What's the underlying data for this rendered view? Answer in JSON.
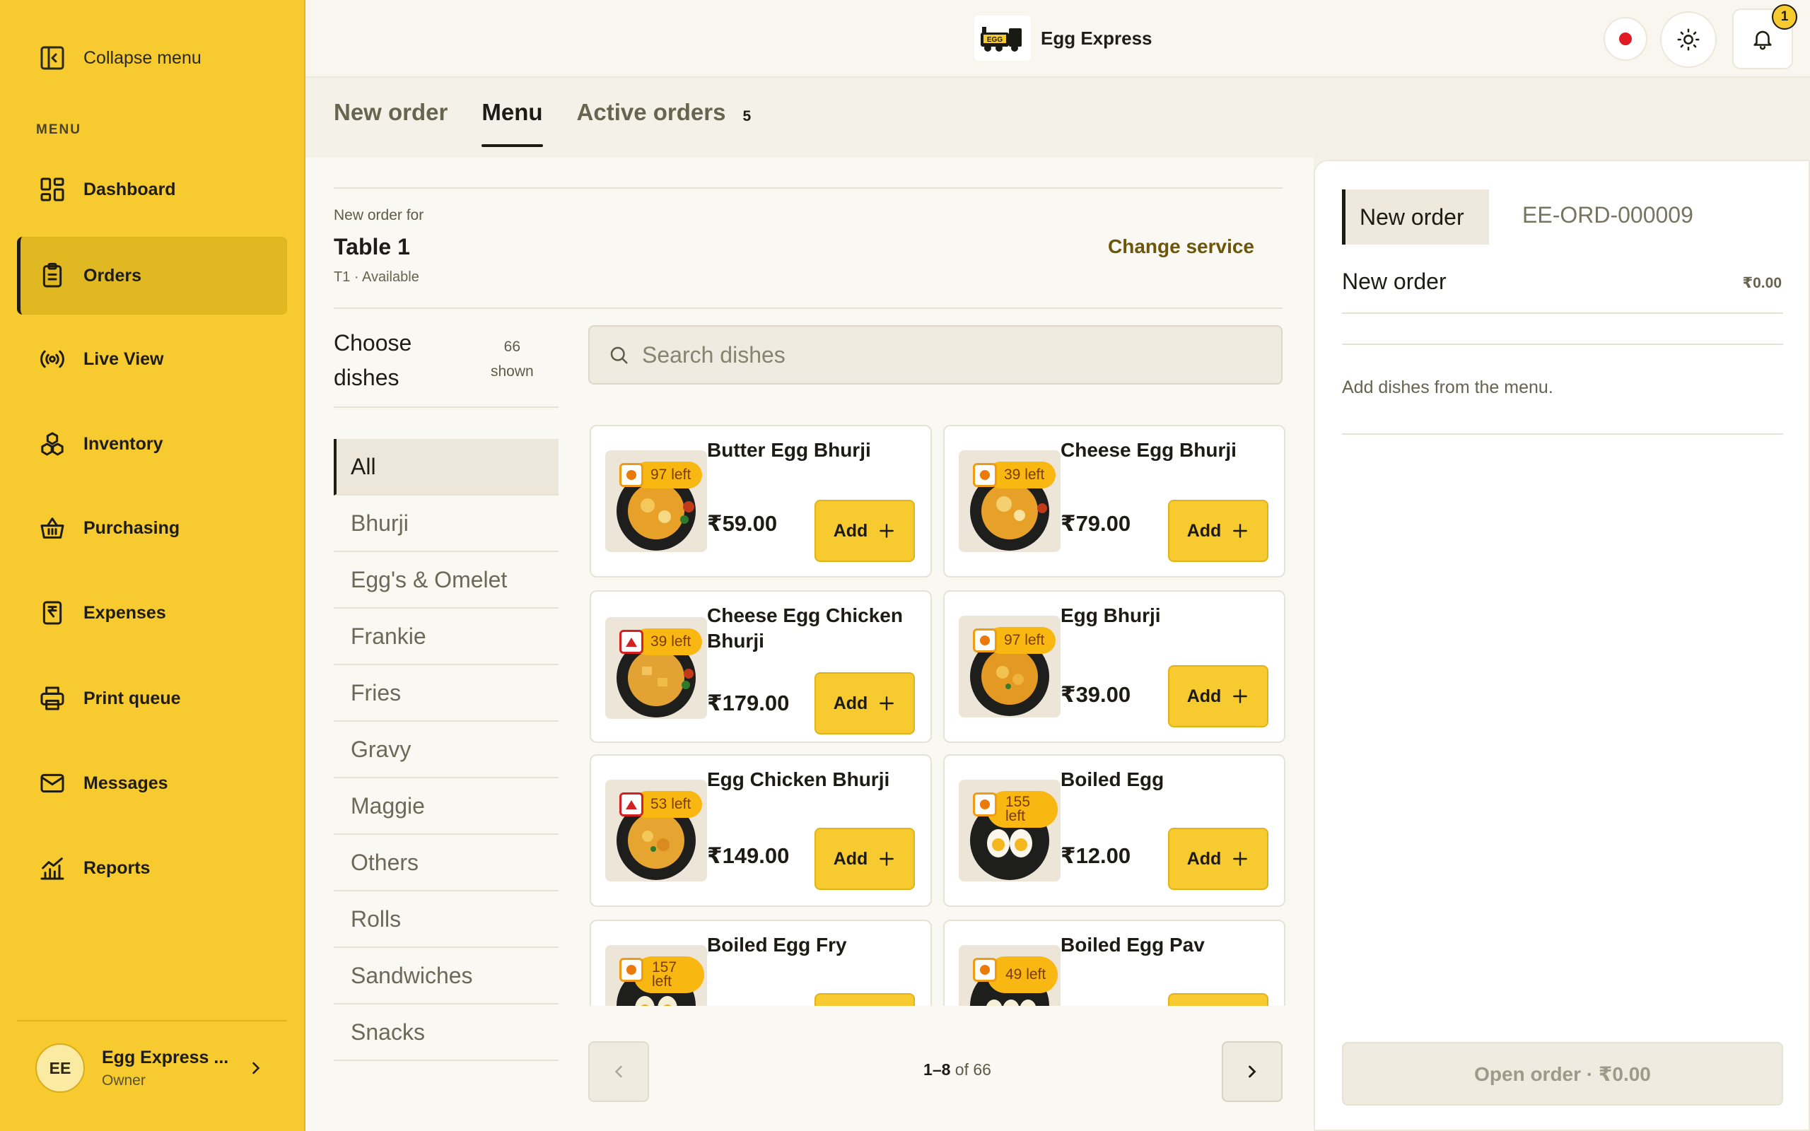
{
  "sidebar": {
    "collapse_label": "Collapse menu",
    "section_label": "MENU",
    "items": [
      {
        "label": "Dashboard",
        "icon": "dashboard-icon"
      },
      {
        "label": "Orders",
        "icon": "clipboard-icon",
        "active": true
      },
      {
        "label": "Live View",
        "icon": "broadcast-icon"
      },
      {
        "label": "Inventory",
        "icon": "boxes-icon"
      },
      {
        "label": "Purchasing",
        "icon": "basket-icon"
      },
      {
        "label": "Expenses",
        "icon": "rupee-receipt-icon"
      },
      {
        "label": "Print queue",
        "icon": "printer-icon"
      },
      {
        "label": "Messages",
        "icon": "mail-icon"
      },
      {
        "label": "Reports",
        "icon": "chart-icon"
      }
    ],
    "user": {
      "initials": "EE",
      "name": "Egg Express ...",
      "role": "Owner"
    }
  },
  "topbar": {
    "brand_name": "Egg Express",
    "logo_text": "EGG",
    "notification_count": "1"
  },
  "tabs": [
    {
      "label": "New order"
    },
    {
      "label": "Menu",
      "active": true
    },
    {
      "label": "Active orders",
      "count": "5"
    }
  ],
  "order_header": {
    "for_label": "New order for",
    "table_name": "Table 1",
    "table_status": "T1 · Available",
    "change_service": "Change service"
  },
  "dishes_header": {
    "title": "Choose dishes",
    "count": "66",
    "count_suffix": "shown"
  },
  "categories": [
    "All",
    "Bhurji",
    "Egg's & Omelet",
    "Frankie",
    "Fries",
    "Gravy",
    "Maggie",
    "Others",
    "Rolls",
    "Sandwiches",
    "Snacks"
  ],
  "search": {
    "placeholder": "Search dishes"
  },
  "add_label": "Add",
  "dishes": [
    {
      "name": "Butter Egg Bhurji",
      "price": "₹59.00",
      "stock": "97 left",
      "type": "veg"
    },
    {
      "name": "Cheese Egg Bhurji",
      "price": "₹79.00",
      "stock": "39 left",
      "type": "veg"
    },
    {
      "name": "Cheese Egg Chicken Bhurji",
      "price": "₹179.00",
      "stock": "39 left",
      "type": "nonveg"
    },
    {
      "name": "Egg Bhurji",
      "price": "₹39.00",
      "stock": "97 left",
      "type": "veg"
    },
    {
      "name": "Egg Chicken Bhurji",
      "price": "₹149.00",
      "stock": "53 left",
      "type": "nonveg"
    },
    {
      "name": "Boiled Egg",
      "price": "₹12.00",
      "stock": "155 left",
      "type": "veg"
    },
    {
      "name": "Boiled Egg Fry",
      "price": "",
      "stock": "157 left",
      "type": "veg"
    },
    {
      "name": "Boiled Egg Pav",
      "price": "",
      "stock": "49 left",
      "type": "veg"
    }
  ],
  "pagination": {
    "range": "1–8",
    "of_label": "of 66"
  },
  "order_panel": {
    "tab_active": "New order",
    "tab_other": "EE-ORD-000009",
    "title": "New order",
    "total": "₹0.00",
    "empty_text": "Add dishes from the menu.",
    "button_label": "Open order · ₹0.00"
  },
  "colors": {
    "accent": "#f7ca2f",
    "stock_badge": "#f8b711",
    "veg": "#ea7a0a",
    "nonveg": "#d42020",
    "record_dot": "#e01b24"
  }
}
